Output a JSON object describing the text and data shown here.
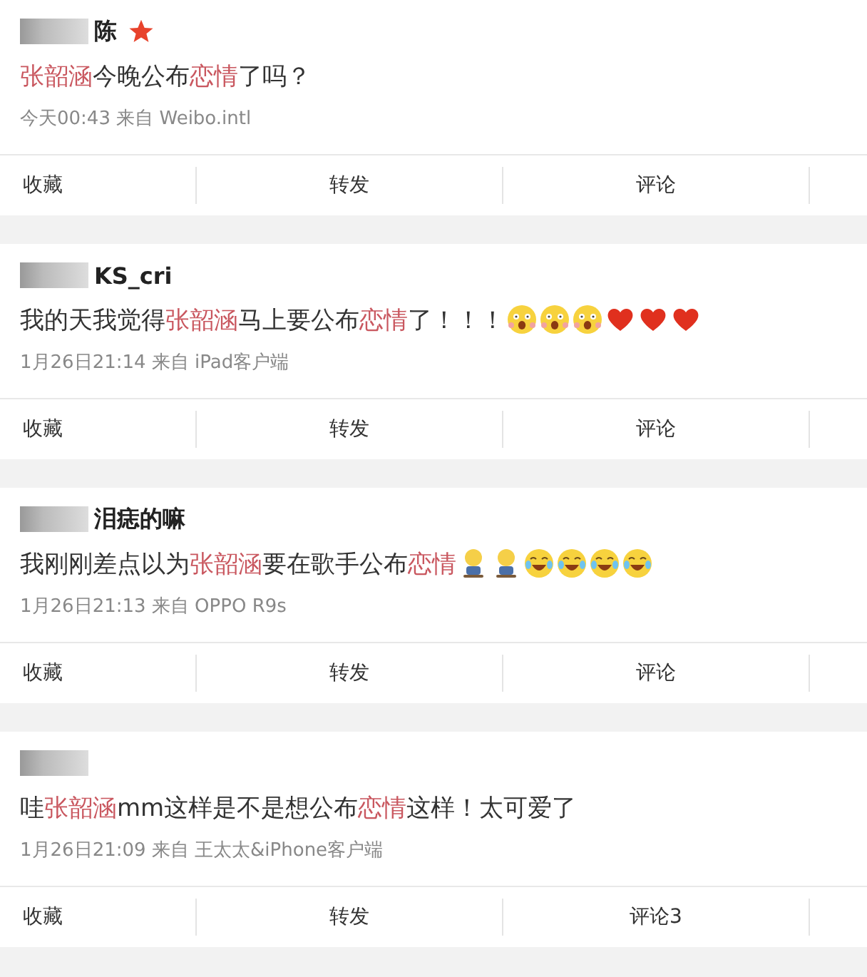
{
  "posts": [
    {
      "user": {
        "name": "陈",
        "blurred": true,
        "star": true
      },
      "text": [
        {
          "t": "张韶涵",
          "highlight": true
        },
        {
          "t": "今晚公布",
          "highlight": false
        },
        {
          "t": "恋情",
          "highlight": true
        },
        {
          "t": "了吗？",
          "highlight": false
        }
      ],
      "meta": "今天00:43 来自 Weibo.intl",
      "actions": [
        "收藏",
        "转发",
        "评论"
      ]
    },
    {
      "user": {
        "name": "KS_cri",
        "blurred": true,
        "star": false
      },
      "text": [
        {
          "t": "我的天我觉得",
          "highlight": false
        },
        {
          "t": "张韶涵",
          "highlight": true
        },
        {
          "t": "马上要公布",
          "highlight": false
        },
        {
          "t": "恋情",
          "highlight": true
        },
        {
          "t": "了！！！",
          "highlight": false
        }
      ],
      "emoji": [
        {
          "kind": "shock"
        },
        {
          "kind": "shock"
        },
        {
          "kind": "shock"
        },
        {
          "kind": "heart"
        },
        {
          "kind": "heart"
        },
        {
          "kind": "heart"
        }
      ],
      "meta": "1月26日21:14 来自 iPad客户端",
      "actions": [
        "收藏",
        "转发",
        "评论"
      ]
    },
    {
      "user": {
        "name": "泪痣的嘛",
        "blurred": true,
        "star": false
      },
      "text": [
        {
          "t": "我刚刚差点以为",
          "highlight": false
        },
        {
          "t": "张韶涵",
          "highlight": true
        },
        {
          "t": "要在歌手公布",
          "highlight": false
        },
        {
          "t": "恋情",
          "highlight": true
        }
      ],
      "emoji": [
        {
          "kind": "child"
        },
        {
          "kind": "child"
        },
        {
          "kind": "cry"
        },
        {
          "kind": "cry"
        },
        {
          "kind": "cry"
        },
        {
          "kind": "cry"
        }
      ],
      "meta": "1月26日21:13 来自 OPPO R9s",
      "actions": [
        "收藏",
        "转发",
        "评论"
      ]
    },
    {
      "user": {
        "blurred": true,
        "star": false
      },
      "text": [
        {
          "t": "哇",
          "highlight": false
        },
        {
          "t": "张韶涵",
          "highlight": true
        },
        {
          "t": "mm这样是不是想公布",
          "highlight": false
        },
        {
          "t": "恋情",
          "highlight": true
        },
        {
          "t": "这样！太可爱了",
          "highlight": false
        }
      ],
      "meta": "1月26日21:09 来自 王太太&iPhone客户端",
      "actions": [
        "收藏",
        "转发",
        "评论3"
      ]
    }
  ]
}
